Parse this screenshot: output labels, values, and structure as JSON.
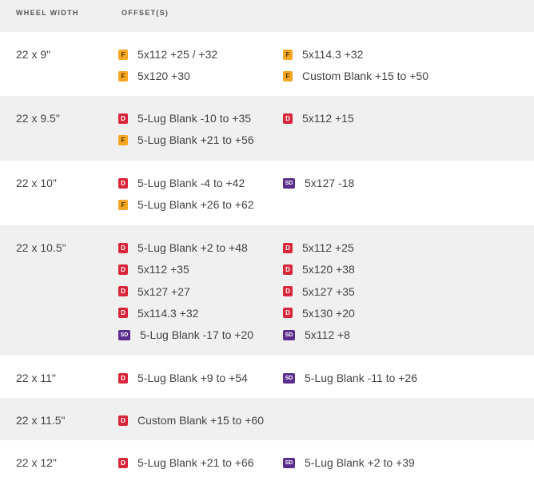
{
  "header": {
    "wheel_width": "WHEEL WIDTH",
    "offsets": "OFFSET(S)"
  },
  "legend_colors": {
    "F": "#f5a623",
    "D": "#d8263a",
    "SD": "#5b2d8e"
  },
  "rows": [
    {
      "width": "22 x 9\"",
      "entries": [
        {
          "badge": "F",
          "text": "5x112 +25 / +32"
        },
        {
          "badge": "F",
          "text": "5x114.3 +32"
        },
        {
          "badge": "F",
          "text": "5x120 +30"
        },
        {
          "badge": "F",
          "text": "Custom Blank +15 to +50"
        }
      ]
    },
    {
      "width": "22 x 9.5\"",
      "entries": [
        {
          "badge": "D",
          "text": "5-Lug Blank -10 to +35"
        },
        {
          "badge": "D",
          "text": "5x112 +15"
        },
        {
          "badge": "F",
          "text": "5-Lug Blank +21 to +56"
        }
      ]
    },
    {
      "width": "22 x 10\"",
      "entries": [
        {
          "badge": "D",
          "text": "5-Lug Blank -4 to +42"
        },
        {
          "badge": "SD",
          "text": "5x127 -18"
        },
        {
          "badge": "F",
          "text": "5-Lug Blank +26 to +62"
        }
      ]
    },
    {
      "width": "22 x 10.5\"",
      "entries": [
        {
          "badge": "D",
          "text": "5-Lug Blank +2 to +48"
        },
        {
          "badge": "D",
          "text": "5x112 +25"
        },
        {
          "badge": "D",
          "text": "5x112 +35"
        },
        {
          "badge": "D",
          "text": "5x120 +38"
        },
        {
          "badge": "D",
          "text": "5x127 +27"
        },
        {
          "badge": "D",
          "text": "5x127 +35"
        },
        {
          "badge": "D",
          "text": "5x114.3 +32"
        },
        {
          "badge": "D",
          "text": "5x130 +20"
        },
        {
          "badge": "SD",
          "text": "5-Lug Blank -17 to +20"
        },
        {
          "badge": "SD",
          "text": "5x112 +8"
        }
      ]
    },
    {
      "width": "22 x 11\"",
      "entries": [
        {
          "badge": "D",
          "text": "5-Lug Blank +9 to +54"
        },
        {
          "badge": "SD",
          "text": "5-Lug Blank -11 to +26"
        }
      ]
    },
    {
      "width": "22 x 11.5\"",
      "entries": [
        {
          "badge": "D",
          "text": "Custom Blank +15 to +60"
        }
      ]
    },
    {
      "width": "22 x 12\"",
      "entries": [
        {
          "badge": "D",
          "text": "5-Lug Blank +21 to +66"
        },
        {
          "badge": "SD",
          "text": "5-Lug Blank +2 to +39"
        }
      ]
    }
  ]
}
